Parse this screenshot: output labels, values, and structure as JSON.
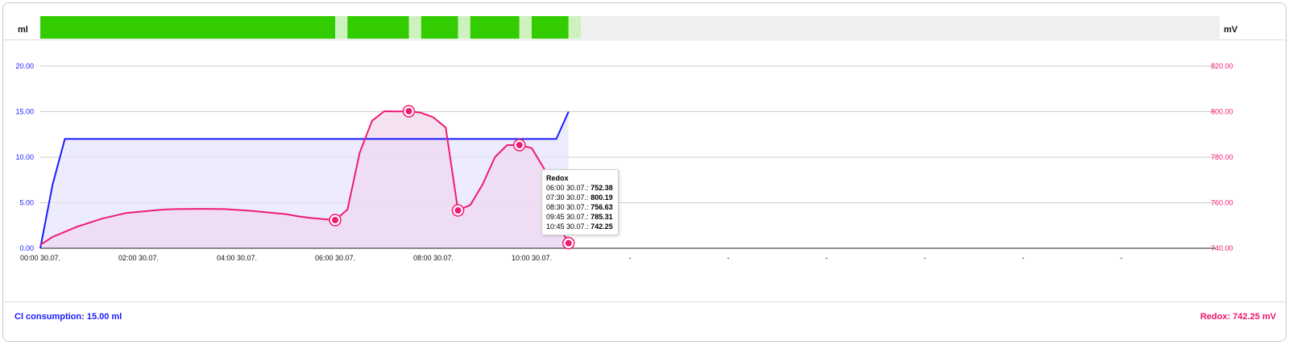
{
  "header": {
    "left_unit": "ml",
    "right_unit": "mV"
  },
  "status_bar": {
    "colors": {
      "on": "#33cc00",
      "off": "#cdf2c0",
      "empty": "#efefef"
    },
    "segments": [
      {
        "state": "on",
        "start": 0,
        "end": 6
      },
      {
        "state": "off",
        "start": 6,
        "end": 6.25
      },
      {
        "state": "on",
        "start": 6.25,
        "end": 7.5
      },
      {
        "state": "off",
        "start": 7.5,
        "end": 7.75
      },
      {
        "state": "on",
        "start": 7.75,
        "end": 8.5
      },
      {
        "state": "off",
        "start": 8.5,
        "end": 8.75
      },
      {
        "state": "on",
        "start": 8.75,
        "end": 9.75
      },
      {
        "state": "off",
        "start": 9.75,
        "end": 10
      },
      {
        "state": "on",
        "start": 10,
        "end": 10.75
      },
      {
        "state": "off",
        "start": 10.75,
        "end": 11
      },
      {
        "state": "empty",
        "start": 11,
        "end": 24
      }
    ]
  },
  "chart_data": {
    "type": "line",
    "x_unit": "hours",
    "xlim": [
      0,
      24
    ],
    "x_tick_labels": [
      "00:00 30.07.",
      "02:00 30.07.",
      "04:00 30.07.",
      "06:00 30.07.",
      "08:00 30.07.",
      "10:00 30.07.",
      "-",
      "-",
      "-",
      "-",
      "-",
      "-"
    ],
    "y_left": {
      "unit": "ml",
      "lim": [
        0,
        20
      ],
      "ticks": [
        "0.00",
        "5.00",
        "10.00",
        "15.00",
        "20.00"
      ]
    },
    "y_right": {
      "unit": "mV",
      "lim": [
        740,
        820
      ],
      "ticks": [
        "740.00",
        "760.00",
        "780.00",
        "800.00",
        "820.00"
      ]
    },
    "grid": true,
    "series": [
      {
        "name": "Cl consumption",
        "axis": "left",
        "color": "#1a1aff",
        "fill": "#e6e6fc",
        "x": [
          0,
          0.25,
          0.5,
          10.5,
          10.75
        ],
        "y": [
          0,
          7,
          12,
          12,
          15
        ]
      },
      {
        "name": "Redox",
        "axis": "right",
        "color": "#f01a73",
        "fill": "#f0d8ef",
        "x": [
          0,
          0.25,
          0.75,
          1.25,
          1.75,
          2.25,
          2.5,
          2.75,
          3.25,
          3.75,
          4.25,
          4.5,
          4.75,
          5,
          5.25,
          5.5,
          5.75,
          6,
          6.25,
          6.5,
          6.75,
          7,
          7.25,
          7.5,
          7.75,
          8,
          8.25,
          8.5,
          8.75,
          9,
          9.25,
          9.5,
          9.75,
          10,
          10.25,
          10.5,
          10.75
        ],
        "y": [
          741.5,
          745,
          749.5,
          753,
          755.5,
          756.5,
          757,
          757.2,
          757.3,
          757.2,
          756.5,
          756,
          755.5,
          755,
          754,
          753.3,
          752.8,
          752.38,
          757,
          782,
          796,
          800.19,
          800.1,
          800.19,
          799.5,
          797.5,
          793,
          756.63,
          759,
          768,
          780,
          785.31,
          785.31,
          784,
          775,
          752,
          742.25
        ]
      }
    ],
    "markers": [
      {
        "series": "Redox",
        "x": 6,
        "y": 752.38
      },
      {
        "series": "Redox",
        "x": 7.5,
        "y": 800.19
      },
      {
        "series": "Redox",
        "x": 8.5,
        "y": 756.63
      },
      {
        "series": "Redox",
        "x": 9.75,
        "y": 785.31
      },
      {
        "series": "Redox",
        "x": 10.75,
        "y": 742.25
      }
    ]
  },
  "tooltip": {
    "title": "Redox",
    "rows": [
      {
        "label": "06:00 30.07.:",
        "value": "752.38"
      },
      {
        "label": "07:30 30.07.:",
        "value": "800.19"
      },
      {
        "label": "08:30 30.07.:",
        "value": "756.63"
      },
      {
        "label": "09:45 30.07.:",
        "value": "785.31"
      },
      {
        "label": "10:45 30.07.:",
        "value": "742.25"
      }
    ]
  },
  "footer": {
    "left": "Cl consumption: 15.00 ml",
    "right": "Redox: 742.25 mV",
    "left_color": "#1a1aff",
    "right_color": "#e8176b"
  }
}
